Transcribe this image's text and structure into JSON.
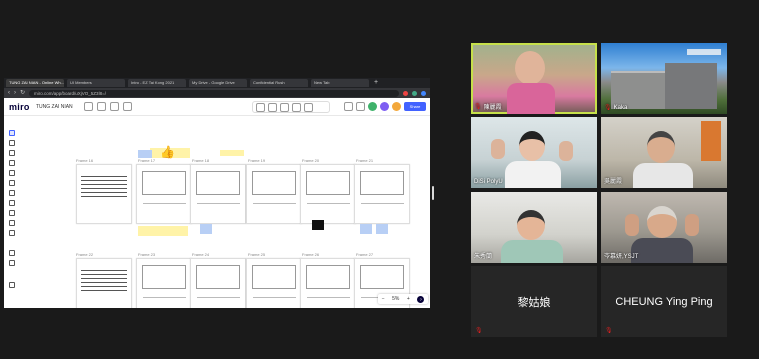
{
  "browser": {
    "tabs": [
      {
        "label": "TUNG ZAI NIAN - Online Wh...",
        "active": true
      },
      {
        "label": "UI Members",
        "active": false
      },
      {
        "label": "Intro - EZ Tai Kong 2021",
        "active": false
      },
      {
        "label": "My Drive - Google Drive",
        "active": false
      },
      {
        "label": "Confidential Rush",
        "active": false
      },
      {
        "label": "New Tab",
        "active": false
      }
    ],
    "url": "miro.com/app/board/uXjVO_5Z3l8=/"
  },
  "miro": {
    "logo": "miro",
    "board_name": "TUNG ZAI NIAN",
    "share_label": "Share",
    "zoom_level": "5%"
  },
  "frames_row1": [
    "Frame 16",
    "Frame 17",
    "Frame 18",
    "Frame 19",
    "Frame 20",
    "Frame 21"
  ],
  "frames_row2": [
    "Frame 22",
    "Frame 23",
    "Frame 24",
    "Frame 25",
    "Frame 26",
    "Frame 27"
  ],
  "participants": [
    {
      "name": "陳麗霞"
    },
    {
      "name": "Kaka"
    },
    {
      "name": "DiSi PolyU"
    },
    {
      "name": "吳麗霞"
    },
    {
      "name": "朱秀蘭"
    },
    {
      "name": "岑慕妍,YSJT"
    },
    {
      "name": "黎姑娘"
    },
    {
      "name": "CHEUNG Ying Ping"
    }
  ],
  "colors": {
    "background": "#1a1a1a",
    "active_speaker": "#c6e04a",
    "muted": "#e02020",
    "miro_blue": "#4262ff"
  }
}
